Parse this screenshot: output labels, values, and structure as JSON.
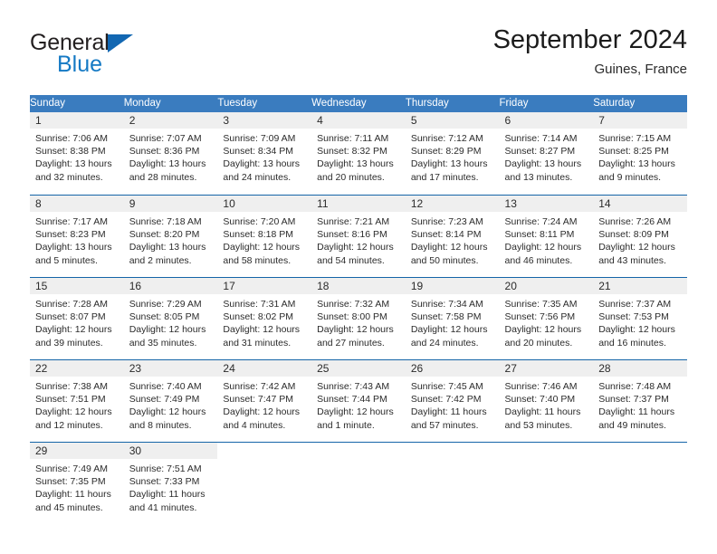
{
  "logo": {
    "word_primary": "General",
    "word_secondary": "Blue",
    "triangle_icon": "triangle-icon",
    "primary_color": "#231f20",
    "secondary_color": "#1479c4",
    "triangle_color": "#1267b2"
  },
  "header": {
    "title": "September 2024",
    "subtitle": "Guines, France"
  },
  "theme": {
    "header_row_bg": "#3a7cbf",
    "header_row_text": "#ffffff",
    "daynum_band_bg": "#efefef",
    "week_separator": "#1565a8",
    "body_text": "#2b2b2b"
  },
  "weekday_headers": [
    "Sunday",
    "Monday",
    "Tuesday",
    "Wednesday",
    "Thursday",
    "Friday",
    "Saturday"
  ],
  "weeks": [
    {
      "days": [
        {
          "date": "1",
          "sunrise": "Sunrise: 7:06 AM",
          "sunset": "Sunset: 8:38 PM",
          "daylight_line1": "Daylight: 13 hours",
          "daylight_line2": "and 32 minutes."
        },
        {
          "date": "2",
          "sunrise": "Sunrise: 7:07 AM",
          "sunset": "Sunset: 8:36 PM",
          "daylight_line1": "Daylight: 13 hours",
          "daylight_line2": "and 28 minutes."
        },
        {
          "date": "3",
          "sunrise": "Sunrise: 7:09 AM",
          "sunset": "Sunset: 8:34 PM",
          "daylight_line1": "Daylight: 13 hours",
          "daylight_line2": "and 24 minutes."
        },
        {
          "date": "4",
          "sunrise": "Sunrise: 7:11 AM",
          "sunset": "Sunset: 8:32 PM",
          "daylight_line1": "Daylight: 13 hours",
          "daylight_line2": "and 20 minutes."
        },
        {
          "date": "5",
          "sunrise": "Sunrise: 7:12 AM",
          "sunset": "Sunset: 8:29 PM",
          "daylight_line1": "Daylight: 13 hours",
          "daylight_line2": "and 17 minutes."
        },
        {
          "date": "6",
          "sunrise": "Sunrise: 7:14 AM",
          "sunset": "Sunset: 8:27 PM",
          "daylight_line1": "Daylight: 13 hours",
          "daylight_line2": "and 13 minutes."
        },
        {
          "date": "7",
          "sunrise": "Sunrise: 7:15 AM",
          "sunset": "Sunset: 8:25 PM",
          "daylight_line1": "Daylight: 13 hours",
          "daylight_line2": "and 9 minutes."
        }
      ]
    },
    {
      "days": [
        {
          "date": "8",
          "sunrise": "Sunrise: 7:17 AM",
          "sunset": "Sunset: 8:23 PM",
          "daylight_line1": "Daylight: 13 hours",
          "daylight_line2": "and 5 minutes."
        },
        {
          "date": "9",
          "sunrise": "Sunrise: 7:18 AM",
          "sunset": "Sunset: 8:20 PM",
          "daylight_line1": "Daylight: 13 hours",
          "daylight_line2": "and 2 minutes."
        },
        {
          "date": "10",
          "sunrise": "Sunrise: 7:20 AM",
          "sunset": "Sunset: 8:18 PM",
          "daylight_line1": "Daylight: 12 hours",
          "daylight_line2": "and 58 minutes."
        },
        {
          "date": "11",
          "sunrise": "Sunrise: 7:21 AM",
          "sunset": "Sunset: 8:16 PM",
          "daylight_line1": "Daylight: 12 hours",
          "daylight_line2": "and 54 minutes."
        },
        {
          "date": "12",
          "sunrise": "Sunrise: 7:23 AM",
          "sunset": "Sunset: 8:14 PM",
          "daylight_line1": "Daylight: 12 hours",
          "daylight_line2": "and 50 minutes."
        },
        {
          "date": "13",
          "sunrise": "Sunrise: 7:24 AM",
          "sunset": "Sunset: 8:11 PM",
          "daylight_line1": "Daylight: 12 hours",
          "daylight_line2": "and 46 minutes."
        },
        {
          "date": "14",
          "sunrise": "Sunrise: 7:26 AM",
          "sunset": "Sunset: 8:09 PM",
          "daylight_line1": "Daylight: 12 hours",
          "daylight_line2": "and 43 minutes."
        }
      ]
    },
    {
      "days": [
        {
          "date": "15",
          "sunrise": "Sunrise: 7:28 AM",
          "sunset": "Sunset: 8:07 PM",
          "daylight_line1": "Daylight: 12 hours",
          "daylight_line2": "and 39 minutes."
        },
        {
          "date": "16",
          "sunrise": "Sunrise: 7:29 AM",
          "sunset": "Sunset: 8:05 PM",
          "daylight_line1": "Daylight: 12 hours",
          "daylight_line2": "and 35 minutes."
        },
        {
          "date": "17",
          "sunrise": "Sunrise: 7:31 AM",
          "sunset": "Sunset: 8:02 PM",
          "daylight_line1": "Daylight: 12 hours",
          "daylight_line2": "and 31 minutes."
        },
        {
          "date": "18",
          "sunrise": "Sunrise: 7:32 AM",
          "sunset": "Sunset: 8:00 PM",
          "daylight_line1": "Daylight: 12 hours",
          "daylight_line2": "and 27 minutes."
        },
        {
          "date": "19",
          "sunrise": "Sunrise: 7:34 AM",
          "sunset": "Sunset: 7:58 PM",
          "daylight_line1": "Daylight: 12 hours",
          "daylight_line2": "and 24 minutes."
        },
        {
          "date": "20",
          "sunrise": "Sunrise: 7:35 AM",
          "sunset": "Sunset: 7:56 PM",
          "daylight_line1": "Daylight: 12 hours",
          "daylight_line2": "and 20 minutes."
        },
        {
          "date": "21",
          "sunrise": "Sunrise: 7:37 AM",
          "sunset": "Sunset: 7:53 PM",
          "daylight_line1": "Daylight: 12 hours",
          "daylight_line2": "and 16 minutes."
        }
      ]
    },
    {
      "days": [
        {
          "date": "22",
          "sunrise": "Sunrise: 7:38 AM",
          "sunset": "Sunset: 7:51 PM",
          "daylight_line1": "Daylight: 12 hours",
          "daylight_line2": "and 12 minutes."
        },
        {
          "date": "23",
          "sunrise": "Sunrise: 7:40 AM",
          "sunset": "Sunset: 7:49 PM",
          "daylight_line1": "Daylight: 12 hours",
          "daylight_line2": "and 8 minutes."
        },
        {
          "date": "24",
          "sunrise": "Sunrise: 7:42 AM",
          "sunset": "Sunset: 7:47 PM",
          "daylight_line1": "Daylight: 12 hours",
          "daylight_line2": "and 4 minutes."
        },
        {
          "date": "25",
          "sunrise": "Sunrise: 7:43 AM",
          "sunset": "Sunset: 7:44 PM",
          "daylight_line1": "Daylight: 12 hours",
          "daylight_line2": "and 1 minute."
        },
        {
          "date": "26",
          "sunrise": "Sunrise: 7:45 AM",
          "sunset": "Sunset: 7:42 PM",
          "daylight_line1": "Daylight: 11 hours",
          "daylight_line2": "and 57 minutes."
        },
        {
          "date": "27",
          "sunrise": "Sunrise: 7:46 AM",
          "sunset": "Sunset: 7:40 PM",
          "daylight_line1": "Daylight: 11 hours",
          "daylight_line2": "and 53 minutes."
        },
        {
          "date": "28",
          "sunrise": "Sunrise: 7:48 AM",
          "sunset": "Sunset: 7:37 PM",
          "daylight_line1": "Daylight: 11 hours",
          "daylight_line2": "and 49 minutes."
        }
      ]
    },
    {
      "days": [
        {
          "date": "29",
          "sunrise": "Sunrise: 7:49 AM",
          "sunset": "Sunset: 7:35 PM",
          "daylight_line1": "Daylight: 11 hours",
          "daylight_line2": "and 45 minutes."
        },
        {
          "date": "30",
          "sunrise": "Sunrise: 7:51 AM",
          "sunset": "Sunset: 7:33 PM",
          "daylight_line1": "Daylight: 11 hours",
          "daylight_line2": "and 41 minutes."
        },
        {
          "date": "",
          "sunrise": "",
          "sunset": "",
          "daylight_line1": "",
          "daylight_line2": ""
        },
        {
          "date": "",
          "sunrise": "",
          "sunset": "",
          "daylight_line1": "",
          "daylight_line2": ""
        },
        {
          "date": "",
          "sunrise": "",
          "sunset": "",
          "daylight_line1": "",
          "daylight_line2": ""
        },
        {
          "date": "",
          "sunrise": "",
          "sunset": "",
          "daylight_line1": "",
          "daylight_line2": ""
        },
        {
          "date": "",
          "sunrise": "",
          "sunset": "",
          "daylight_line1": "",
          "daylight_line2": ""
        }
      ]
    }
  ]
}
